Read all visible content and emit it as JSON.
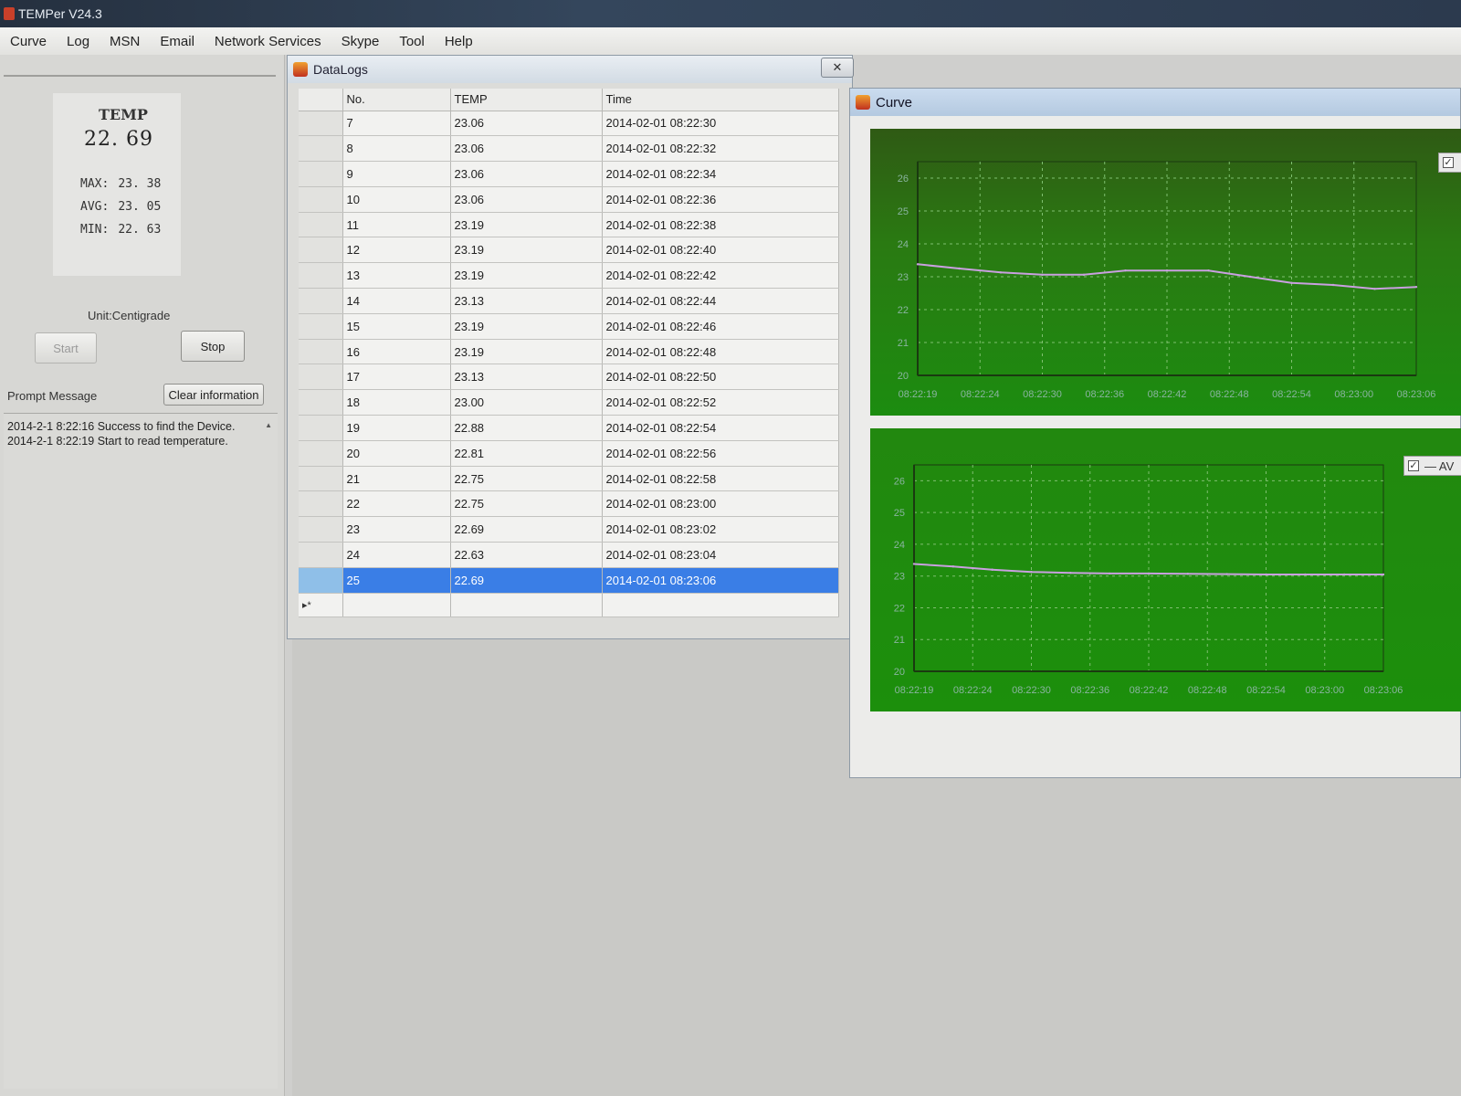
{
  "app": {
    "title": "TEMPer V24.3"
  },
  "menu": [
    "Curve",
    "Log",
    "MSN",
    "Email",
    "Network Services",
    "Skype",
    "Tool",
    "Help"
  ],
  "display": {
    "label": "TEMP",
    "value": "22. 69",
    "max_label": "MAX:",
    "max_value": "23. 38",
    "avg_label": "AVG:",
    "avg_value": "23. 05",
    "min_label": "MIN:",
    "min_value": "22. 63",
    "unit": "Unit:Centigrade"
  },
  "buttons": {
    "start": "Start",
    "stop": "Stop",
    "clear": "Clear information"
  },
  "prompt": {
    "label": "Prompt Message",
    "lines": [
      "2014-2-1 8:22:16 Success to find the Device.",
      "2014-2-1 8:22:19 Start to read temperature."
    ]
  },
  "datalogs": {
    "title": "DataLogs",
    "close": "✕",
    "columns": [
      "No.",
      "TEMP",
      "Time"
    ],
    "rows": [
      [
        "7",
        "23.06",
        "2014-02-01 08:22:30"
      ],
      [
        "8",
        "23.06",
        "2014-02-01 08:22:32"
      ],
      [
        "9",
        "23.06",
        "2014-02-01 08:22:34"
      ],
      [
        "10",
        "23.06",
        "2014-02-01 08:22:36"
      ],
      [
        "11",
        "23.19",
        "2014-02-01 08:22:38"
      ],
      [
        "12",
        "23.19",
        "2014-02-01 08:22:40"
      ],
      [
        "13",
        "23.19",
        "2014-02-01 08:22:42"
      ],
      [
        "14",
        "23.13",
        "2014-02-01 08:22:44"
      ],
      [
        "15",
        "23.19",
        "2014-02-01 08:22:46"
      ],
      [
        "16",
        "23.19",
        "2014-02-01 08:22:48"
      ],
      [
        "17",
        "23.13",
        "2014-02-01 08:22:50"
      ],
      [
        "18",
        "23.00",
        "2014-02-01 08:22:52"
      ],
      [
        "19",
        "22.88",
        "2014-02-01 08:22:54"
      ],
      [
        "20",
        "22.81",
        "2014-02-01 08:22:56"
      ],
      [
        "21",
        "22.75",
        "2014-02-01 08:22:58"
      ],
      [
        "22",
        "22.75",
        "2014-02-01 08:23:00"
      ],
      [
        "23",
        "22.69",
        "2014-02-01 08:23:02"
      ],
      [
        "24",
        "22.63",
        "2014-02-01 08:23:04"
      ],
      [
        "25",
        "22.69",
        "2014-02-01 08:23:06"
      ]
    ],
    "selected_row": 18,
    "new_row_marker": "▸*"
  },
  "curve": {
    "title": "Curve",
    "legend_top": "",
    "legend_bottom": "— AV"
  },
  "colors": {
    "chart_line": "#c9a0e0",
    "grid": "#7fc070",
    "axis": "#1a3a10",
    "tick": "#8ab4a0",
    "selection": "#3a7ee6"
  },
  "chart_data": [
    {
      "type": "line",
      "title": "",
      "x": [
        "08:22:19",
        "08:22:24",
        "08:22:30",
        "08:22:36",
        "08:22:42",
        "08:22:48",
        "08:22:54",
        "08:23:00",
        "08:23:06"
      ],
      "y_ticks": [
        26,
        25,
        24,
        23,
        22,
        21,
        20
      ],
      "ylim": [
        20,
        26.5
      ],
      "series": [
        {
          "values": [
            23.38,
            23.25,
            23.13,
            23.06,
            23.06,
            23.19,
            23.19,
            23.19,
            23.0,
            22.81,
            22.75,
            22.63,
            22.69
          ]
        }
      ],
      "grid": true
    },
    {
      "type": "line",
      "title": "",
      "x": [
        "08:22:19",
        "08:22:24",
        "08:22:30",
        "08:22:36",
        "08:22:42",
        "08:22:48",
        "08:22:54",
        "08:23:00",
        "08:23:06"
      ],
      "y_ticks": [
        26,
        25,
        24,
        23,
        22,
        21,
        20
      ],
      "ylim": [
        20,
        26.5
      ],
      "series": [
        {
          "values": [
            23.38,
            23.3,
            23.2,
            23.13,
            23.1,
            23.08,
            23.08,
            23.07,
            23.06,
            23.05,
            23.05,
            23.05,
            23.05
          ]
        }
      ],
      "grid": true
    }
  ]
}
